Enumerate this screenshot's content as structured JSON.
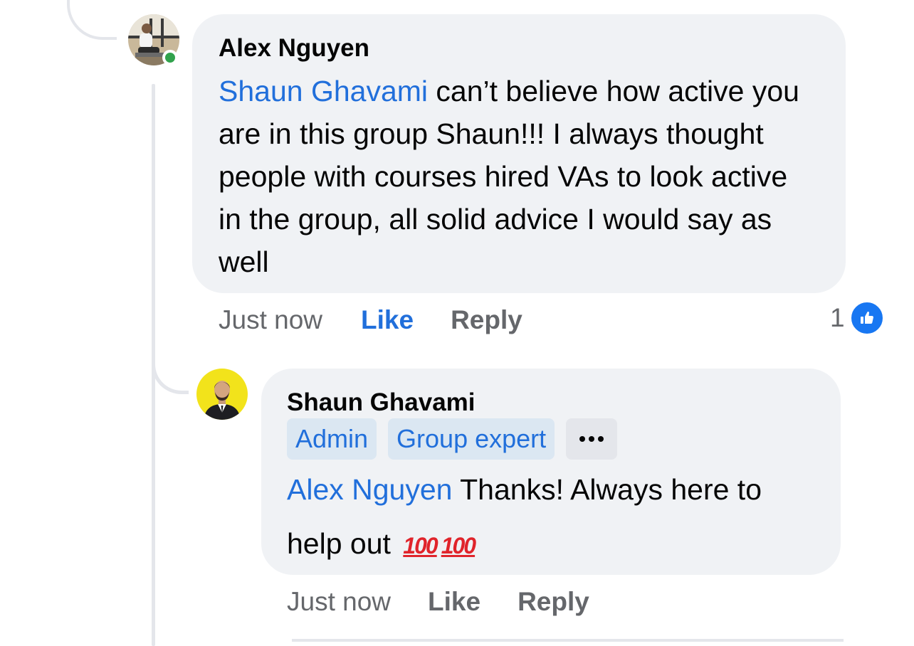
{
  "comment": {
    "author": "Alex Nguyen",
    "mention": "Shaun Ghavami",
    "text": " can’t believe how active you are in this group Shaun!!! I always thought people with courses hired VAs to look active in the group, all solid advice I would say as well",
    "time": "Just now",
    "like_label": "Like",
    "reply_label": "Reply",
    "reaction_count": "1",
    "reaction_icon": "like-icon",
    "online_status": "online"
  },
  "reply": {
    "author": "Shaun Ghavami",
    "badges": [
      "Admin",
      "Group expert"
    ],
    "mention": "Alex Nguyen",
    "text": " Thanks! Always here to help out ",
    "emoji": [
      "100",
      "100"
    ],
    "time": "Just now",
    "like_label": "Like",
    "reply_label": "Reply"
  },
  "colors": {
    "link": "#216fdb",
    "bubble": "#f0f2f5",
    "badge_bg": "#dbe7f2",
    "online": "#31a24c",
    "like_badge": "#1877f2",
    "emoji_100": "#e0242b"
  }
}
